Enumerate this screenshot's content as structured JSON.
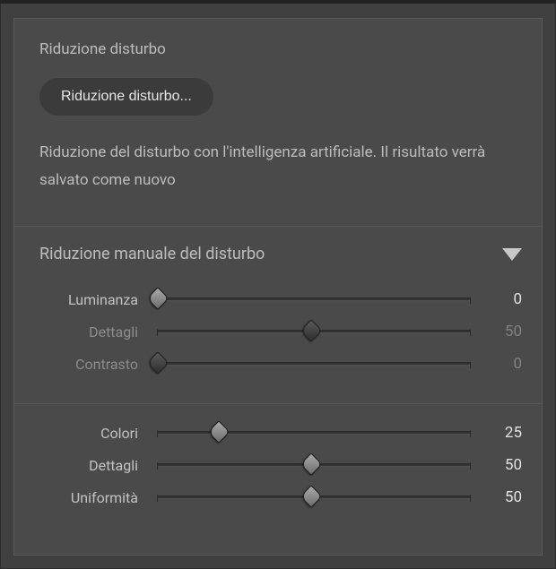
{
  "noise_reduction": {
    "title": "Riduzione disturbo",
    "button_label": "Riduzione disturbo...",
    "description": "Riduzione del disturbo con l'intelligenza artificiale. Il risultato verrà salvato come nuovo"
  },
  "manual": {
    "title": "Riduzione manuale del disturbo",
    "sliders": {
      "luminance": {
        "label": "Luminanza",
        "value": 0,
        "enabled": true,
        "pct": 0
      },
      "details1": {
        "label": "Dettagli",
        "value": 50,
        "enabled": false,
        "pct": 50
      },
      "contrast": {
        "label": "Contrasto",
        "value": 0,
        "enabled": false,
        "pct": 0
      },
      "color": {
        "label": "Colori",
        "value": 25,
        "enabled": true,
        "pct": 20
      },
      "details2": {
        "label": "Dettagli",
        "value": 50,
        "enabled": true,
        "pct": 50
      },
      "uniformity": {
        "label": "Uniformità",
        "value": 50,
        "enabled": true,
        "pct": 50
      }
    }
  }
}
